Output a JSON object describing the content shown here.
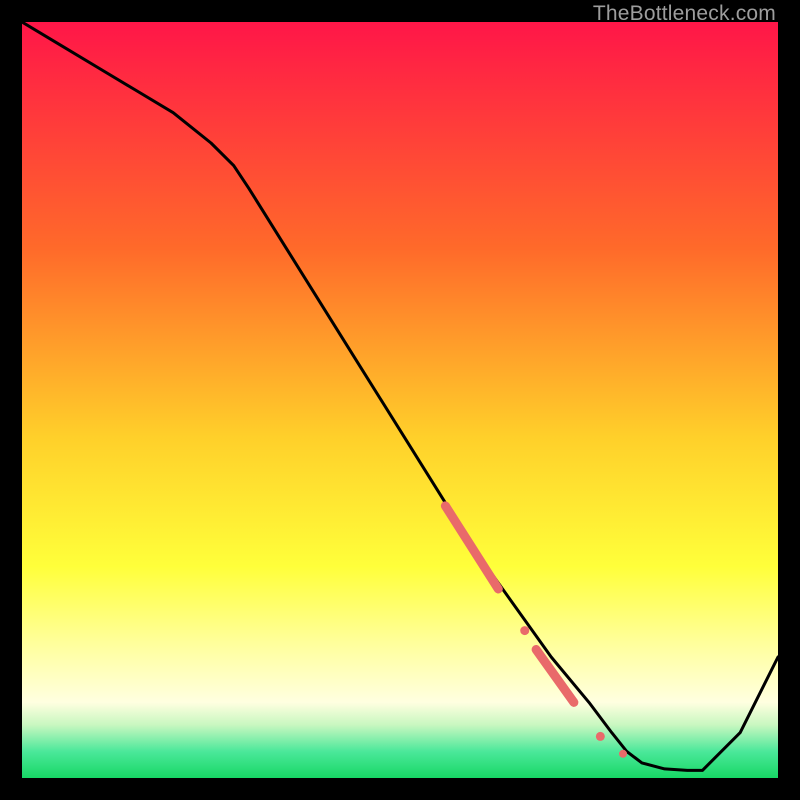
{
  "watermark": "TheBottleneck.com",
  "colors": {
    "frame": "#000000",
    "line": "#000000",
    "marker": "#e96a6a",
    "grad_top": "#ff1648",
    "grad_mid1": "#ff8f2a",
    "grad_mid2": "#ffe52a",
    "grad_band": "#ffff9a",
    "grad_green1": "#8ff0a4",
    "grad_green2": "#1be070"
  },
  "chart_data": {
    "type": "line",
    "title": "",
    "xlabel": "",
    "ylabel": "",
    "xlim": [
      0,
      100
    ],
    "ylim": [
      0,
      100
    ],
    "series": [
      {
        "name": "curve",
        "x": [
          0,
          5,
          10,
          15,
          20,
          25,
          28,
          30,
          35,
          40,
          45,
          50,
          55,
          60,
          65,
          70,
          75,
          78,
          80,
          82,
          85,
          88,
          90,
          95,
          100
        ],
        "y": [
          100,
          97,
          94,
          91,
          88,
          84,
          81,
          78,
          70,
          62,
          54,
          46,
          38,
          30,
          23,
          16,
          10,
          6,
          3.5,
          2,
          1.2,
          1.0,
          1.0,
          6,
          16
        ]
      }
    ],
    "markers": [
      {
        "shape": "line-segment",
        "x0": 56,
        "y0": 36,
        "x1": 63,
        "y1": 25,
        "width": 9
      },
      {
        "shape": "dot",
        "x": 66.5,
        "y": 19.5,
        "r": 4.5
      },
      {
        "shape": "line-segment",
        "x0": 68,
        "y0": 17,
        "x1": 73,
        "y1": 10,
        "width": 9
      },
      {
        "shape": "dot",
        "x": 76.5,
        "y": 5.5,
        "r": 4.5
      },
      {
        "shape": "dot",
        "x": 79.5,
        "y": 3.2,
        "r": 4
      }
    ]
  }
}
